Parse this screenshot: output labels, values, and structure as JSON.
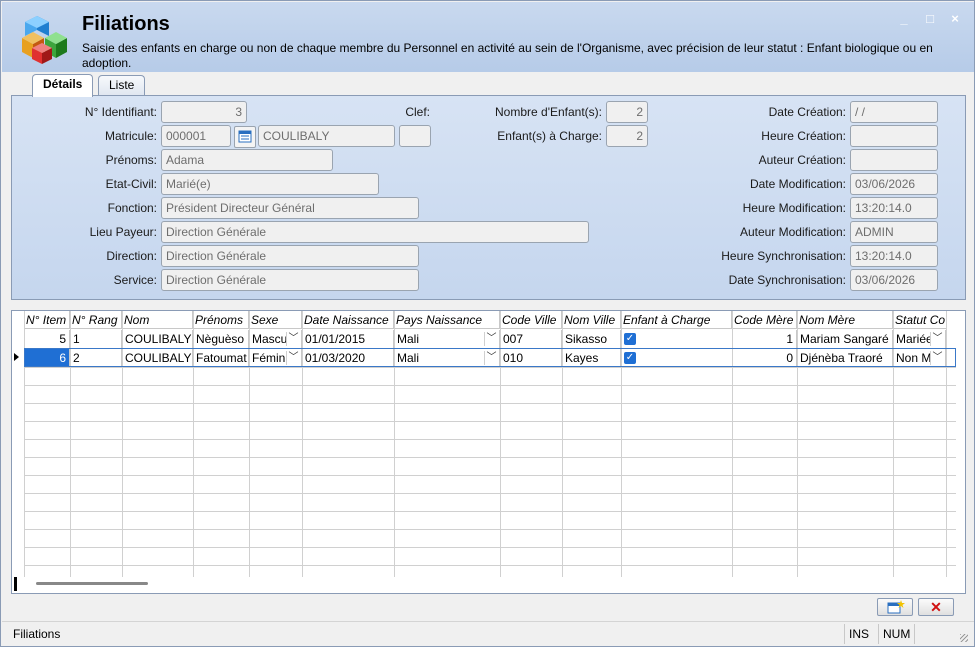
{
  "window": {
    "title": "Filiations",
    "description": "Saisie des enfants en charge ou non de chaque membre du Personnel en activité au sein de l'Organisme, avec précision de leur statut : Enfant biologique ou en adoption.",
    "minimize": "_",
    "maximize": "□",
    "close": "×"
  },
  "tabs": [
    {
      "label": "Détails",
      "active": true
    },
    {
      "label": "Liste",
      "active": false
    }
  ],
  "form": {
    "identifiant_label": "N° Identifiant:",
    "identifiant_value": "3",
    "clef_label": "Clef:",
    "clef_value": "",
    "nb_enfants_label": "Nombre d'Enfant(s):",
    "nb_enfants_value": "2",
    "enfants_charge_label": "Enfant(s) à Charge:",
    "enfants_charge_value": "2",
    "matricule_label": "Matricule:",
    "matricule_value": "000001",
    "nom_value": "COULIBALY",
    "prenoms_label": "Prénoms:",
    "prenoms_value": "Adama",
    "etat_civil_label": "Etat-Civil:",
    "etat_civil_value": "Marié(e)",
    "fonction_label": "Fonction:",
    "fonction_value": "Président Directeur Général",
    "lieu_payeur_label": "Lieu Payeur:",
    "lieu_payeur_value": "Direction Générale",
    "direction_label": "Direction:",
    "direction_value": "Direction Générale",
    "service_label": "Service:",
    "service_value": "Direction Générale",
    "date_creation_label": "Date Création:",
    "date_creation_value": " / /",
    "heure_creation_label": "Heure Création:",
    "heure_creation_value": "",
    "auteur_creation_label": "Auteur Création:",
    "auteur_creation_value": "",
    "date_modif_label": "Date Modification:",
    "date_modif_value": "03/06/2026",
    "heure_modif_label": "Heure Modification:",
    "heure_modif_value": "13:20:14.0",
    "auteur_modif_label": "Auteur Modification:",
    "auteur_modif_value": "ADMIN",
    "heure_sync_label": "Heure Synchronisation:",
    "heure_sync_value": "13:20:14.0",
    "date_sync_label": "Date Synchronisation:",
    "date_sync_value": "03/06/2026"
  },
  "grid": {
    "headers": [
      "N° Item",
      "N° Rang",
      "Nom",
      "Prénoms",
      "Sexe",
      "Date Naissance",
      "Pays Naissance",
      "Code Ville",
      "Nom Ville",
      "Enfant à Charge",
      "Code Mère",
      "Nom Mère",
      "Statut Co"
    ],
    "rows": [
      {
        "item": "5",
        "rang": "1",
        "nom": "COULIBALY",
        "prenoms": "Nèguèso",
        "sexe": "Mascu",
        "date_naissance": "01/01/2015",
        "pays": "Mali",
        "code_ville": "007",
        "nom_ville": "Sikasso",
        "charge": true,
        "code_mere": "1",
        "nom_mere": "Mariam Sangaré",
        "statut": "Mariée"
      },
      {
        "item": "6",
        "rang": "2",
        "nom": "COULIBALY",
        "prenoms": "Fatoumat",
        "sexe": "Fémin",
        "date_naissance": "01/03/2020",
        "pays": "Mali",
        "code_ville": "010",
        "nom_ville": "Kayes",
        "charge": true,
        "code_mere": "0",
        "nom_mere": "Djénèba Traoré",
        "statut": "Non M"
      }
    ]
  },
  "buttons": {
    "new_icon": "new-record-icon",
    "delete_icon": "delete-icon"
  },
  "statusbar": {
    "text": "Filiations",
    "ins": "INS",
    "num": "NUM"
  }
}
